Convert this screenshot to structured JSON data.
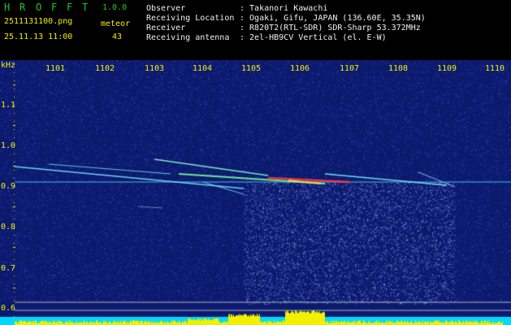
{
  "app": {
    "title_letters": [
      "H",
      "R",
      "O",
      "F",
      "F",
      "T"
    ],
    "version": "1.0.0",
    "filename": "2511131100.png",
    "timestamp": "25.11.13 11:00",
    "meteor_label": "meteor",
    "meteor_count": "43"
  },
  "info": [
    {
      "label": "Observer",
      "value": ": Takanori Kawachi"
    },
    {
      "label": "Receiving Location",
      "value": ": Ogaki, Gifu, JAPAN (136.60E, 35.35N)"
    },
    {
      "label": "Receiver",
      "value": ": R820T2(RTL-SDR) SDR-Sharp 53.372MHz"
    },
    {
      "label": "Receiving antenna",
      "value": ": 2el-HB9CV Vertical (el. E-W)"
    }
  ],
  "x_ticks": [
    "1101",
    "1102",
    "1103",
    "1104",
    "1105",
    "1106",
    "1107",
    "1108",
    "1109",
    "1110"
  ],
  "y_unit": "kHz",
  "y_ticks": [
    "1.1",
    "1.0",
    "0.9",
    "0.8",
    "0.7",
    "0.6"
  ],
  "colors": {
    "background": "#000000",
    "spectrogram_base": "#0c1a6e",
    "label_yellow": "#f0f000",
    "title_green": "#22c822",
    "signal_cyan": "#5ad8ff",
    "meteor_hot": "#ff3030",
    "bottom_strip": "#00d8ff"
  }
}
